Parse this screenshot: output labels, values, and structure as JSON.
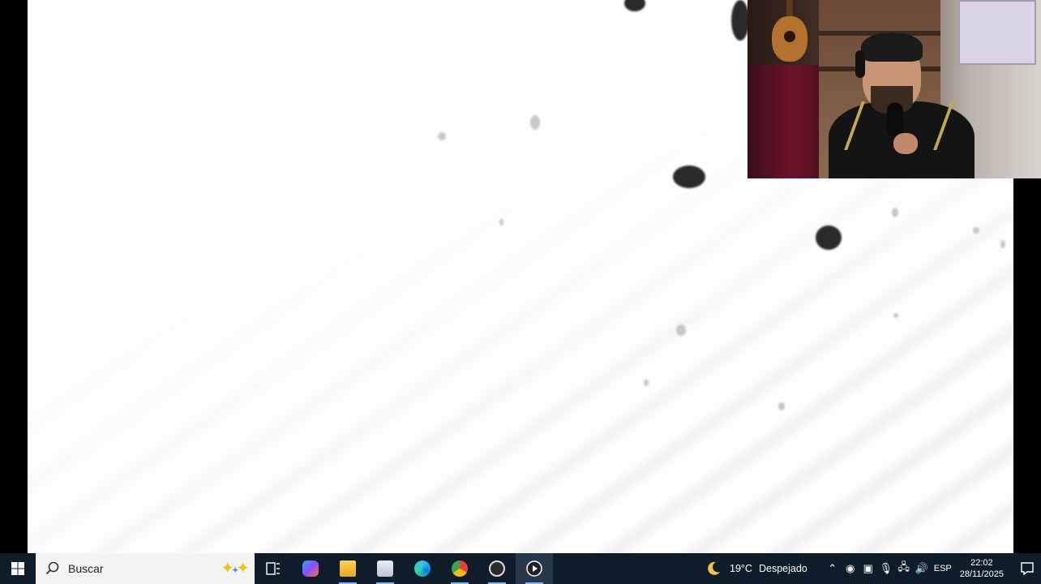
{
  "taskbar": {
    "search_placeholder": "Buscar",
    "apps": [
      {
        "name": "task-view-icon",
        "label": "Vista de tareas"
      },
      {
        "name": "copilot-icon",
        "label": "Copilot"
      },
      {
        "name": "file-explorer-icon",
        "label": "Explorador de archivos"
      },
      {
        "name": "notepad-icon",
        "label": "Bloc de notas"
      },
      {
        "name": "edge-icon",
        "label": "Microsoft Edge"
      },
      {
        "name": "chrome-icon",
        "label": "Google Chrome"
      },
      {
        "name": "obs-icon",
        "label": "OBS Studio"
      },
      {
        "name": "media-player-icon",
        "label": "Reproductor multimedia"
      }
    ],
    "weather": {
      "temp": "19°C",
      "condition": "Despejado"
    },
    "language": "ESP",
    "time": "22:02",
    "date": "28/11/2025"
  },
  "colors": {
    "taskbar_bg": "#0f1d2b",
    "stage_bg": "#fdfdfd",
    "accent": "#7fb6f5"
  }
}
